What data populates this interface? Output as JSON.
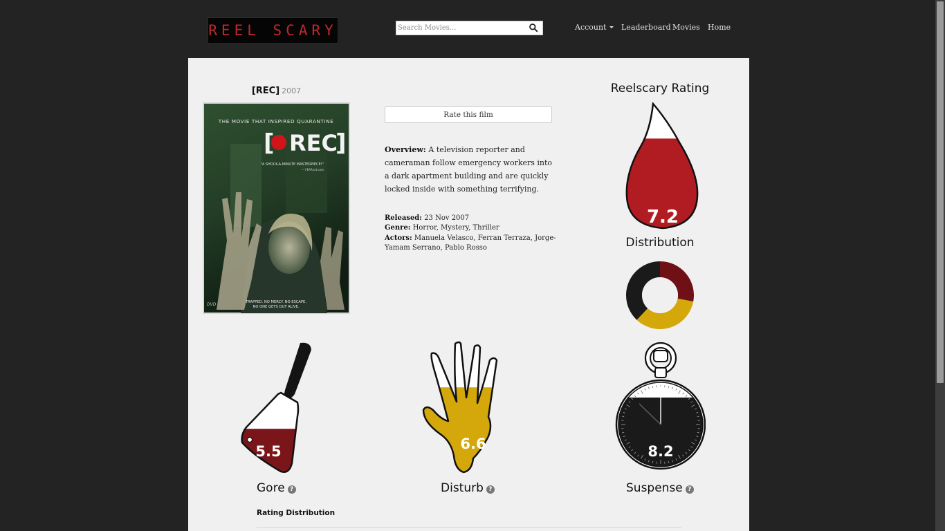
{
  "navbar": {
    "logo_text": "REEL SCARY",
    "search": {
      "placeholder": "Search Movies..."
    },
    "links": {
      "account": "Account",
      "leaderboard": "Leaderboard",
      "movies": "Movies",
      "home": "Home"
    }
  },
  "movie": {
    "title": "[REC]",
    "year": "2007",
    "rate_button": "Rate this film",
    "overview_label": "Overview:",
    "overview": "A television reporter and cameraman follow emergency workers into a dark apartment building and are quickly locked inside with something terrifying.",
    "released_label": "Released:",
    "released": "23 Nov 2007",
    "genre_label": "Genre:",
    "genre": "Horror, Mystery, Thriller",
    "actors_label": "Actors:",
    "actors": "Manuela Velasco, Ferran Terraza, Jorge-Yamam Serrano, Pablo Rosso"
  },
  "poster": {
    "tagline_top": "THE MOVIE THAT INSPIRED QUARANTINE",
    "title": "REC",
    "quote": "\"A SHOCK-A-MINUTE MASTERPIECE!\"",
    "quote_source": "— FEARnet.com",
    "bottom_line1": "TRAPPED. NO MERCY. NO ESCAPE.",
    "bottom_line2": "NO ONE GETS OUT ALIVE.",
    "dvd": "DVD"
  },
  "rating": {
    "title": "Reelscary Rating",
    "value": "7.2",
    "fill_fraction": 0.72
  },
  "distribution": {
    "title": "Distribution",
    "segments": [
      {
        "color": "#6e1015",
        "fraction": 0.28
      },
      {
        "color": "#d4a70a",
        "fraction": 0.34
      },
      {
        "color": "#1a1a1a",
        "fraction": 0.38
      }
    ]
  },
  "metrics": {
    "gore": {
      "label": "Gore",
      "value": "5.5",
      "fill_fraction": 0.55,
      "color": "#7a1519"
    },
    "disturb": {
      "label": "Disturb",
      "value": "6.6",
      "fill_fraction": 0.66,
      "color": "#d4a70a"
    },
    "suspense": {
      "label": "Suspense",
      "value": "8.2",
      "fill_fraction": 0.82,
      "color": "#1a1a1a"
    }
  },
  "help_icon": "?",
  "rating_distribution_title": "Rating Distribution"
}
